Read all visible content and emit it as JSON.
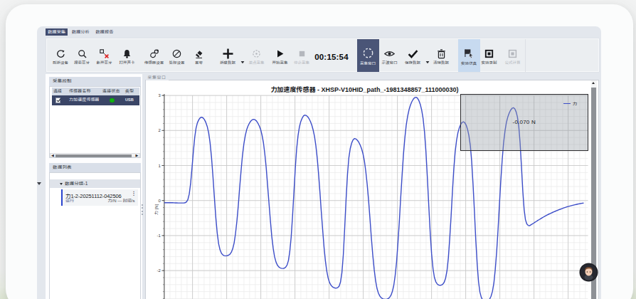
{
  "tabs": [
    {
      "label": "数据采集",
      "active": true
    },
    {
      "label": "数据分析",
      "active": false
    },
    {
      "label": "数据报告",
      "active": false
    }
  ],
  "toolbar": {
    "items": [
      {
        "id": "refresh-device",
        "label": "刷新设备",
        "icon": "refresh-icon"
      },
      {
        "id": "search-bluetooth",
        "label": "搜索蓝牙",
        "icon": "search-icon"
      },
      {
        "id": "disconnect-bluetooth",
        "label": "断开蓝牙",
        "icon": "bluetooth-disconnect-icon"
      },
      {
        "id": "open-soundcard",
        "label": "打开声卡",
        "icon": "bell-icon"
      },
      {
        "id": "sensor-settings",
        "label": "传感器设置",
        "icon": "sensor-icon"
      },
      {
        "id": "process-settings",
        "label": "处理设置",
        "icon": "gauge-icon"
      },
      {
        "id": "set-zero",
        "label": "置零",
        "icon": "eraser-icon"
      },
      {
        "id": "new-data",
        "label": "新建数据",
        "icon": "plus-icon",
        "dropdown": true
      },
      {
        "id": "single-point",
        "label": "单点采集",
        "icon": "single-point-icon",
        "disabled": true
      },
      {
        "id": "start-acquisition",
        "label": "开始采集",
        "icon": "play-icon"
      },
      {
        "id": "stop-acquisition",
        "label": "停止采集",
        "icon": "stop-icon",
        "disabled": true
      }
    ],
    "timer": "00:15:54",
    "window_buttons": [
      {
        "id": "acquisition-window",
        "label": "采集窗口",
        "icon": "dashed-circle-icon",
        "active": true
      },
      {
        "id": "scope-window",
        "label": "示波窗口",
        "icon": "eye-icon"
      },
      {
        "id": "save-data",
        "label": "保存数据",
        "icon": "check-icon",
        "dropdown": true
      },
      {
        "id": "clear-data",
        "label": "清除数据",
        "icon": "trash-icon"
      },
      {
        "id": "experiment-simulation",
        "label": "实验仿真",
        "icon": "sim-icon",
        "highlighted": true
      },
      {
        "id": "experiment-recording",
        "label": "实验录制",
        "icon": "record-icon"
      },
      {
        "id": "formula-calc",
        "label": "公式计算",
        "icon": "formula-icon",
        "disabled": true
      }
    ]
  },
  "sidebar": {
    "acquisition_control": {
      "title": "采集控制",
      "table": {
        "headers": [
          "选择",
          "传感器名称",
          "连接状态",
          "类型"
        ],
        "rows": [
          {
            "checked": true,
            "name": "力加速度传感器",
            "status_color": "#11b211",
            "type": "USB",
            "selected": true
          }
        ]
      }
    },
    "data_list": {
      "title": "数据列表",
      "groups": [
        {
          "label": "数据分组-1",
          "expanded": true,
          "items": [
            {
              "name": "力1-2-20251112-042506",
              "status": "运行",
              "axes": "力/N — 时间/s",
              "menu": "⋮"
            }
          ]
        }
      ]
    }
  },
  "chart_panel": {
    "group_label": "采集窗口",
    "readout": "-0.070 N",
    "legend": [
      {
        "label": "力",
        "color": "#3c4dc8"
      }
    ]
  },
  "chart_data": {
    "type": "line",
    "title": "力加速度传感器 - XHSP-V10HID_path_-1981348857_111000030)",
    "ylabel": "力 [N]",
    "xlabel": "",
    "y_ticks": [
      3,
      2,
      1,
      0,
      -1,
      -2
    ],
    "ylim_visible": [
      -2.95,
      3.1
    ],
    "grid": "major+minor",
    "legend_position": "top-right",
    "cursor_readout": "-0.070 N",
    "series": [
      {
        "name": "力",
        "unit": "N",
        "color": "#3c4dc8",
        "keypoints": [
          [
            0.0,
            -0.06
          ],
          [
            0.046,
            -0.07
          ],
          [
            0.088,
            2.38
          ],
          [
            0.145,
            -1.58
          ],
          [
            0.211,
            2.32
          ],
          [
            0.28,
            -1.94
          ],
          [
            0.332,
            2.44
          ],
          [
            0.406,
            -2.5
          ],
          [
            0.449,
            1.77
          ],
          [
            0.522,
            -2.82
          ],
          [
            0.594,
            2.95
          ],
          [
            0.651,
            -2.42
          ],
          [
            0.706,
            2.25
          ],
          [
            0.758,
            -2.88
          ],
          [
            0.824,
            2.65
          ],
          [
            0.862,
            -0.72
          ],
          [
            0.901,
            -0.43
          ],
          [
            0.928,
            -0.28
          ],
          [
            0.956,
            -0.16
          ],
          [
            0.985,
            -0.08
          ],
          [
            0.99,
            -0.07
          ]
        ]
      }
    ]
  }
}
